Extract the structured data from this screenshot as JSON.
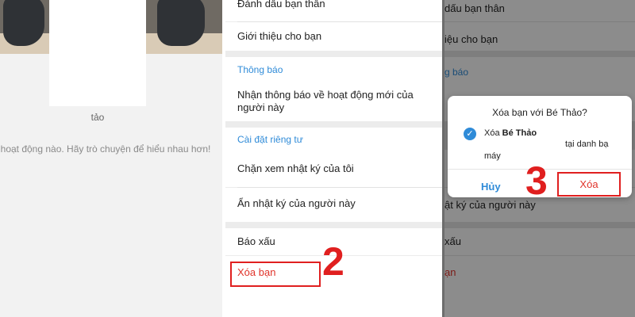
{
  "left_panel": {
    "profile_name": "tảo",
    "empty_message": "a có hoạt động nào. Hãy trò chuyện để hiểu nhau hơn!"
  },
  "menu": {
    "best_friend": "Đánh dấu bạn thân",
    "introduce": "Giới thiệu cho bạn",
    "notifications_section": "Thông báo",
    "notify_activity": "Nhận thông báo về hoạt động mới của người này",
    "privacy_section": "Cài đặt riêng tư",
    "block_diary": "Chặn xem nhật ký của tôi",
    "hide_diary": "Ẩn nhật ký của người này",
    "report": "Báo xấu",
    "delete_friend": "Xóa bạn"
  },
  "right_menu": {
    "best_friend": "dấu bạn thân",
    "introduce": "iệu cho bạn",
    "notifications_section": "g báo",
    "hide_diary": "ật ký của người này",
    "report": "xấu",
    "delete_friend": "ạn"
  },
  "dialog": {
    "title": "Xóa bạn với Bé Thảo?",
    "option_prefix": "Xóa ",
    "option_name": "Bé Thảo",
    "option_tail": "tại danh bạ",
    "option_tail2": "máy",
    "cancel_label": "Hủy",
    "confirm_label": "Xóa"
  },
  "steps": {
    "step2": "2",
    "step3": "3"
  },
  "colors": {
    "accent": "#2f8bd8",
    "danger": "#e0332a",
    "highlight": "#e01f1f"
  }
}
